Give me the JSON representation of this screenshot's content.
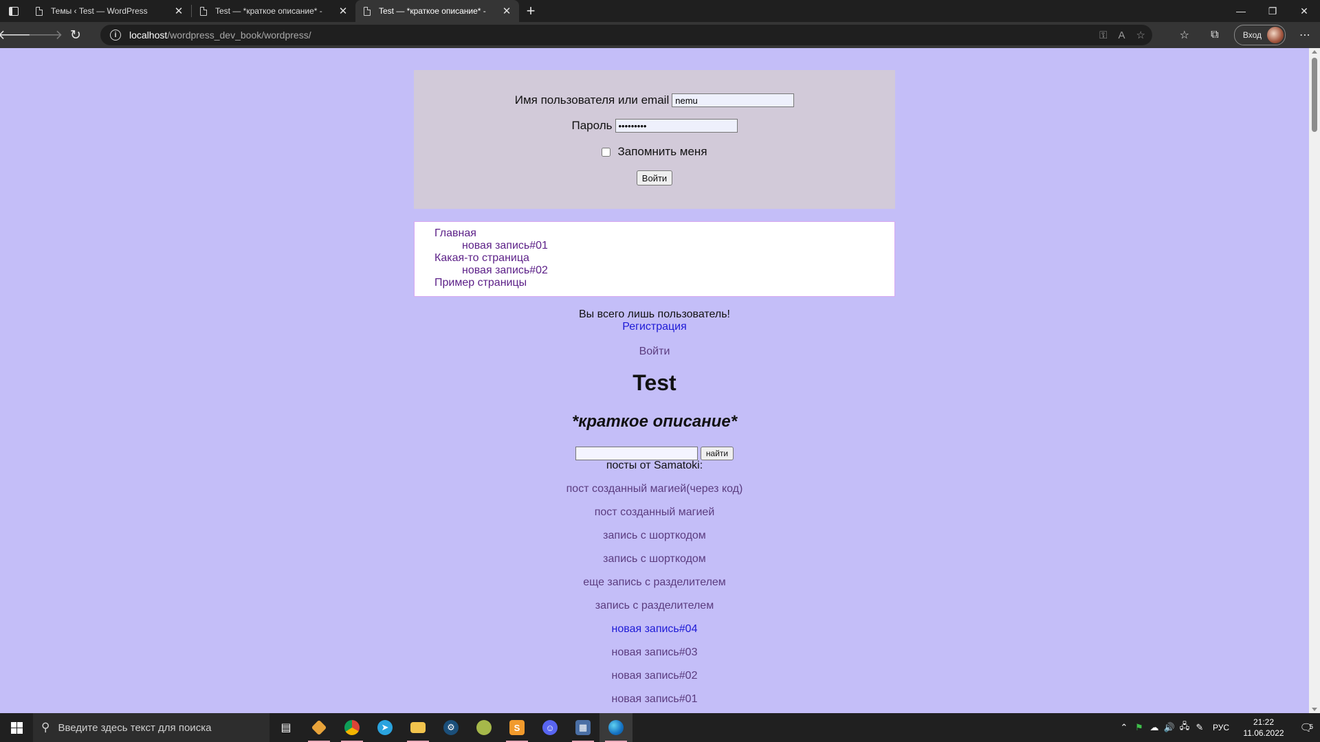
{
  "browser": {
    "tabs": [
      {
        "title": "Темы ‹ Test — WordPress",
        "active": false
      },
      {
        "title": "Test — *краткое описание* - ",
        "active": false
      },
      {
        "title": "Test — *краткое описание* - ",
        "active": true
      }
    ],
    "new_tab": "+",
    "url_host": "localhost",
    "url_path": "/wordpress_dev_book/wordpress/",
    "profile_label": "Вход",
    "window_controls": {
      "minimize": "—",
      "restore": "❐",
      "close": "✕"
    }
  },
  "login_form": {
    "username_label": "Имя пользователя или email",
    "username_value": "nemu",
    "password_label": "Пароль",
    "password_value": "•••••••••",
    "remember_label": "Запомнить меня",
    "remember_checked": false,
    "submit_label": "Войти"
  },
  "menu": {
    "items": [
      {
        "label": "Главная",
        "level": 0
      },
      {
        "label": "новая запись#01",
        "level": 1
      },
      {
        "label": "Какая-то страница",
        "level": 0
      },
      {
        "label": "новая запись#02",
        "level": 1
      },
      {
        "label": "Пример страницы",
        "level": 0
      }
    ]
  },
  "user_block": {
    "message": "Вы всего лишь пользователь!",
    "register_link": "Регистрация",
    "login_link": "Войти"
  },
  "site": {
    "title": "Test",
    "description": "*краткое описание*"
  },
  "search": {
    "value": "",
    "button_label": "найти"
  },
  "posts": {
    "heading": "посты от Samatoki:",
    "items": [
      "пост созданный магией(через код)",
      "пост созданный магией",
      "запись с шорткодом",
      "запись с шорткодом",
      "еще запись с разделителем",
      "запись с разделителем",
      "новая запись#04",
      "новая запись#03",
      "новая запись#02",
      "новая запись#01"
    ]
  },
  "taskbar": {
    "search_placeholder": "Введите здесь текст для поиска",
    "language": "РУС",
    "time": "21:22",
    "date": "11.06.2022",
    "notifications": "5"
  },
  "colors": {
    "page_background": "#c4bef8",
    "login_box": "#d2cad9",
    "menu_link": "#5b1f87",
    "link_blue": "#1e1ad6",
    "link_visited": "#5b3c7f"
  }
}
